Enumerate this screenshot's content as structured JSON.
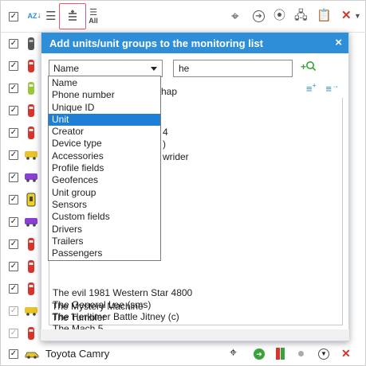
{
  "toolbar": {
    "icons": [
      "checkbox",
      "sort-az-icon",
      "list-icon",
      "add-to-list-icon",
      "all-list-icon",
      "crosshair-icon",
      "go-arrow-icon",
      "signal-icon",
      "network-icon",
      "clipboard-icon",
      "close-icon"
    ],
    "sort_label": "AZ",
    "all_label": "All"
  },
  "dialog": {
    "title": "Add units/unit groups to the monitoring list",
    "close": "×",
    "select_value": "Name",
    "search_value": "he",
    "map_label_fragment": "hap",
    "dropdown_options": [
      "Name",
      "Phone number",
      "Unique ID",
      "Unit",
      "Creator",
      "Device type",
      "Accessories",
      "Profile fields",
      "Geofences",
      "Unit group",
      "Sensors",
      "Custom fields",
      "Drivers",
      "Trailers",
      "Passengers"
    ],
    "selected_option": "Unit",
    "partial_results": [
      {
        "text": "4"
      },
      {
        "text": ")"
      },
      {
        "text": "wrider"
      }
    ],
    "results": [
      "The evil 1981 Western Star 4800",
      "The General Lee (sms)",
      "The Herkimer Battle Jitney (c)",
      "The Mach 5",
      "The Mystery Machine",
      "The Tumbler"
    ]
  },
  "bottom_row": {
    "unit_name": "Toyota Camry",
    "colors": {
      "red": "#d9332b",
      "green": "#3aa23a",
      "blue": "#2e8fd8"
    }
  }
}
